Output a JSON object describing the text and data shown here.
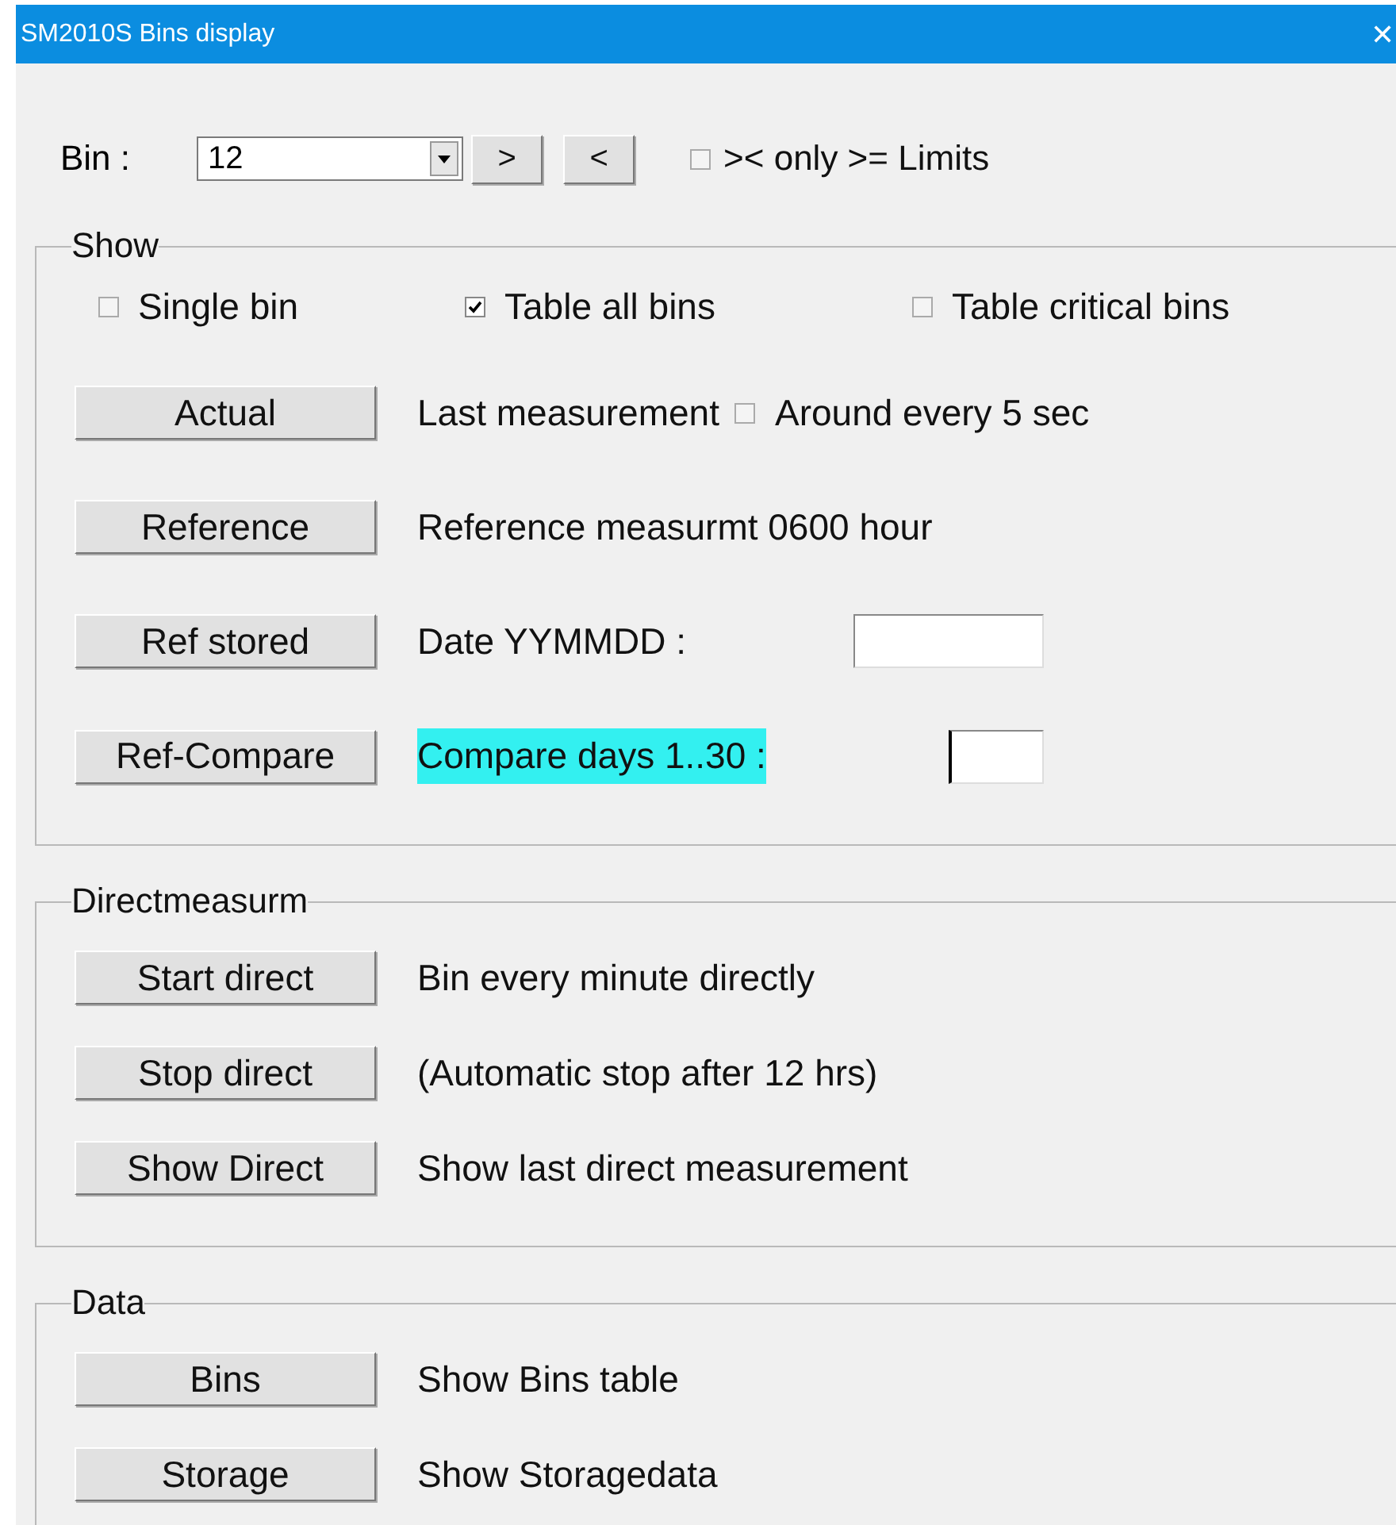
{
  "window": {
    "title": "SM2010S Bins display",
    "close": "✕"
  },
  "bin_row": {
    "label": "Bin :",
    "combo": {
      "value": "12"
    },
    "buttons": [
      ">",
      "<"
    ],
    "limits_checkbox": {
      "label": ">< only >= Limits",
      "checked": false
    }
  },
  "groups": [
    {
      "title": "Show",
      "checkboxes": [
        {
          "label": "Single bin",
          "checked": false
        },
        {
          "label": "Table all bins",
          "checked": true
        },
        {
          "label": "Table critical bins",
          "checked": false
        }
      ],
      "rows": [
        {
          "button": "Actual",
          "text": "Last measurement",
          "checkbox": {
            "label": "Around every 5 sec",
            "checked": false
          }
        },
        {
          "button": "Reference",
          "text": "Reference measurmt 0600 hour"
        },
        {
          "button": "Ref stored",
          "text": "Date YYMMDD :",
          "field": {
            "kind": "wide",
            "focused": false
          }
        },
        {
          "button": "Ref-Compare",
          "text": "Compare days 1..30 :",
          "highlighted": true,
          "field": {
            "kind": "narrow",
            "focused": true
          }
        }
      ]
    },
    {
      "title": "Directmeasurm",
      "rows": [
        {
          "button": "Start direct",
          "text": "Bin every minute directly"
        },
        {
          "button": "Stop direct",
          "text": "(Automatic stop after 12 hrs)"
        },
        {
          "button": "Show Direct",
          "text": "Show last direct measurement"
        }
      ]
    },
    {
      "title": "Data",
      "rows": [
        {
          "button": "Bins",
          "text": "Show Bins table"
        },
        {
          "button": "Storage",
          "text": "Show Storagedata"
        }
      ]
    }
  ]
}
